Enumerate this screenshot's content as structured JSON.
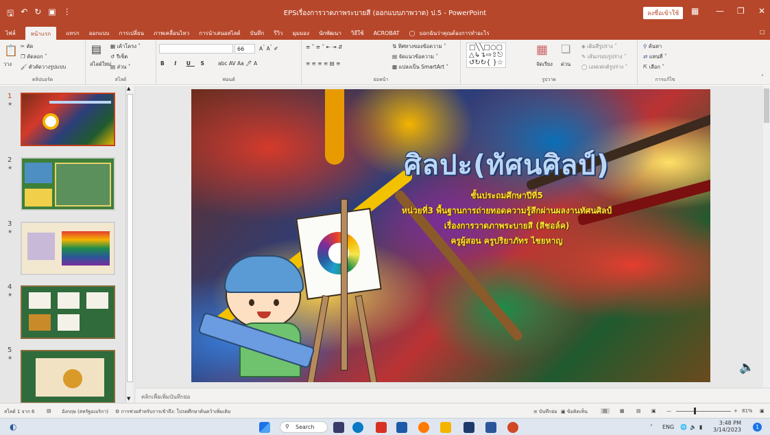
{
  "window": {
    "title": "EPSเรื่องการวาดภาพระบายสี (ออกแบบภาพวาด) ป.5 - PowerPoint",
    "signin_label": "ลงชื่อเข้าใช้"
  },
  "menu": {
    "tabs": [
      "ไฟล์",
      "หน้าแรก",
      "แทรก",
      "ออกแบบ",
      "การเปลี่ยน",
      "ภาพเคลื่อนไหว",
      "การนำเสนอสไลด์",
      "บันทึก",
      "รีวิว",
      "มุมมอง",
      "นักพัฒนา",
      "วิธีใช้",
      "ACROBAT"
    ],
    "active_tab": "หน้าแรก",
    "tell_me": "บอกฉันว่าคุณต้องการทำอะไร"
  },
  "ribbon": {
    "clipboard": {
      "cut": "ตัด",
      "copy": "คัดลอก",
      "format_painter": "ตัวคัดวางรูปแบบ",
      "paste": "วาง",
      "label": "คลิปบอร์ด"
    },
    "slides": {
      "new_slide": "สไลด์ใหม่",
      "layout": "เค้าโครง",
      "reset": "รีเซ็ต",
      "section": "ส่วน",
      "label": "สไลด์"
    },
    "font": {
      "size": "66",
      "label": "ฟอนต์"
    },
    "paragraph": {
      "text_direction": "ทิศทางของข้อความ",
      "align_text": "จัดแนวข้อความ",
      "smartart": "แปลงเป็น SmartArt",
      "label": "ย่อหน้า"
    },
    "drawing": {
      "arrange": "จัดเรียง",
      "quick_styles": "ด่วน",
      "shape_fill": "เติมสีรูปร่าง",
      "shape_outline": "เส้นกรอบรูปร่าง",
      "shape_effects": "เอฟเฟกต์รูปร่าง",
      "label": "รูปวาด"
    },
    "editing": {
      "find": "ค้นหา",
      "replace": "แทนที่",
      "select": "เลือก",
      "label": "การแก้ไข"
    }
  },
  "thumbnails": [
    {
      "num": "1",
      "active": true
    },
    {
      "num": "2",
      "active": false
    },
    {
      "num": "3",
      "active": false
    },
    {
      "num": "4",
      "active": false
    },
    {
      "num": "5",
      "active": false
    }
  ],
  "slide": {
    "title": "ศิลปะ(ทัศนศิลป์)",
    "line1": "ชั้นประถมศึกษาปีที่5",
    "line2": "หน่วยที่3 พื้นฐานการถ่ายทอดความรู้สึกผ่านผลงานทัศนศิลป์",
    "line3": "เรื่องการวาดภาพระบายสี (สีชอล์ค)",
    "line4": "ครูผู้สอน ครูปริยาภัทร ไชยหาญ"
  },
  "notes_placeholder": "คลิกเพื่อเพิ่มบันทึกย่อ",
  "status": {
    "slide_count": "สไลด์ 1 จาก 6",
    "language": "อังกฤษ (สหรัฐอเมริกา)",
    "accessibility": "การช่วยสำหรับการเข้าถึง: โปรดศึกษาค้นคว้าเพิ่มเติม",
    "notes_btn": "บันทึกย่อ",
    "comments_btn": "ข้อคิดเห็น",
    "zoom": "81%"
  },
  "taskbar": {
    "search": "Search",
    "lang": "ENG",
    "time": "3:48 PM",
    "date": "3/14/2023",
    "notification_count": "1"
  },
  "colors": {
    "accent": "#b7472a",
    "active_thumb": "#c43e1c",
    "title_text": "#bcd6f5",
    "subtitle_text": "#ffe23a"
  }
}
